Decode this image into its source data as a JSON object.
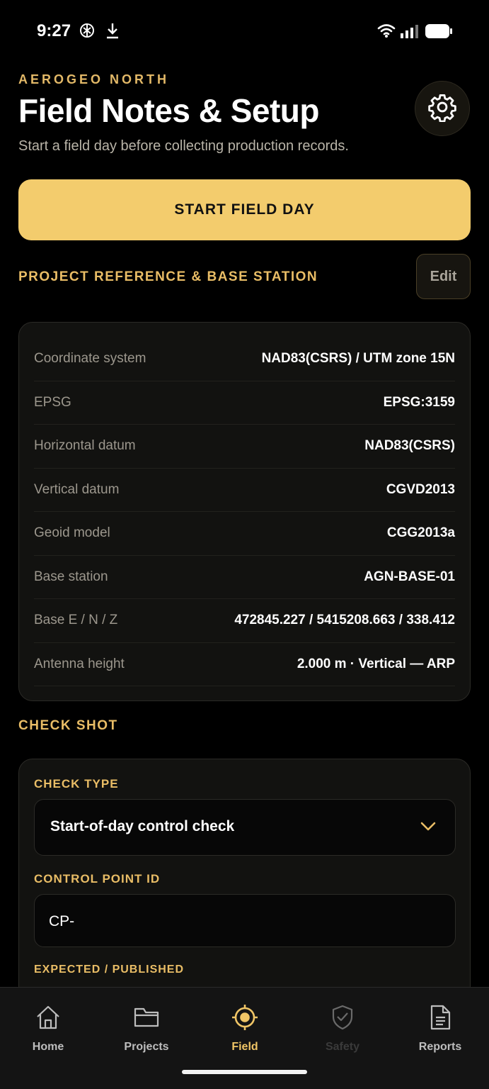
{
  "status_bar": {
    "time": "9:27",
    "icons": [
      "openai-icon",
      "download-icon",
      "wifi-icon",
      "signal-icon",
      "battery-icon"
    ]
  },
  "header": {
    "org": "AEROGEO NORTH",
    "title": "Field Notes & Setup",
    "subtitle": "Start a field day before collecting production records."
  },
  "start_button": {
    "label": "START FIELD DAY"
  },
  "reference": {
    "title": "PROJECT REFERENCE & BASE STATION",
    "edit_label": "Edit",
    "rows": [
      {
        "label": "Coordinate system",
        "value": "NAD83(CSRS) / UTM zone 15N"
      },
      {
        "label": "EPSG",
        "value": "EPSG:3159"
      },
      {
        "label": "Horizontal datum",
        "value": "NAD83(CSRS)"
      },
      {
        "label": "Vertical datum",
        "value": "CGVD2013"
      },
      {
        "label": "Geoid model",
        "value": "CGG2013a"
      },
      {
        "label": "Base station",
        "value": "AGN-BASE-01"
      },
      {
        "label": "Base E / N / Z",
        "value": "472845.227 / 5415208.663 / 338.412"
      },
      {
        "label": "Antenna height",
        "value": "2.000 m · Vertical — ARP"
      }
    ]
  },
  "check_shot": {
    "title": "CHECK SHOT",
    "check_type_label": "CHECK TYPE",
    "check_type_value": "Start-of-day control check",
    "control_point_label": "CONTROL POINT ID",
    "control_point_value": "CP-",
    "expected_label": "EXPECTED / PUBLISHED"
  },
  "nav": {
    "items": [
      {
        "label": "Home",
        "icon": "home-icon"
      },
      {
        "label": "Projects",
        "icon": "folder-icon"
      },
      {
        "label": "Field",
        "icon": "crosshair-icon"
      },
      {
        "label": "Safety",
        "icon": "shield-check-icon"
      },
      {
        "label": "Reports",
        "icon": "document-icon"
      }
    ],
    "active": "Field"
  },
  "colors": {
    "accent": "#f3cc6d",
    "section_gold": "#e9bd66",
    "background": "#000000",
    "card": "#121210"
  }
}
